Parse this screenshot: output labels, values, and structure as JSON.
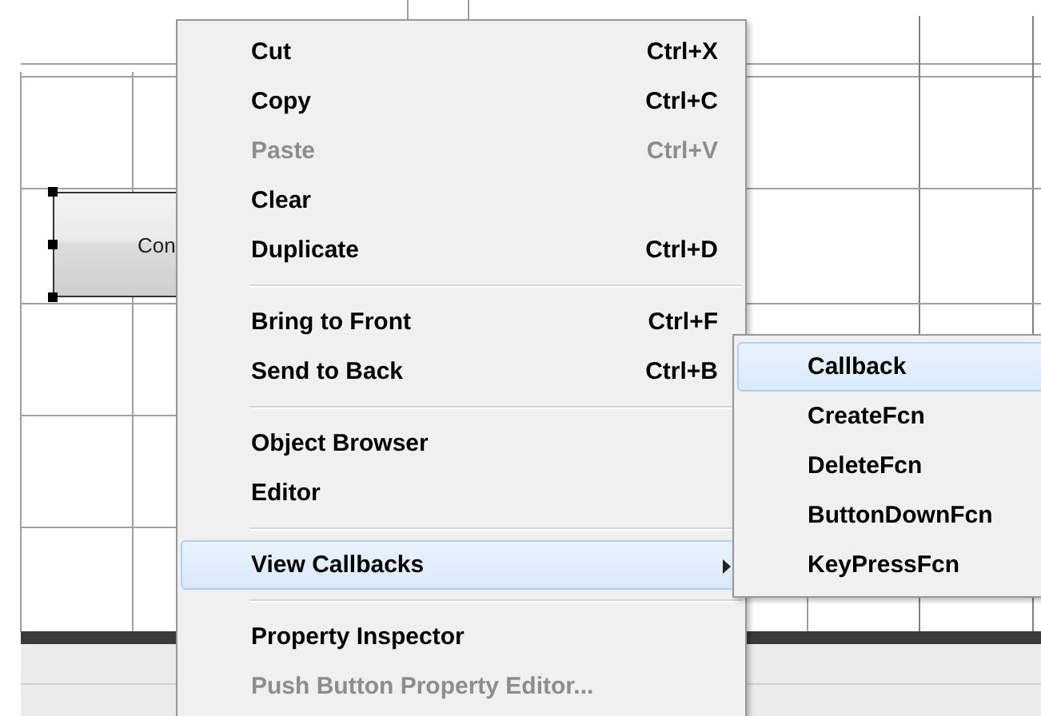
{
  "canvas": {
    "button": {
      "label": "Con",
      "selected": true
    }
  },
  "context_menu": {
    "items": [
      {
        "kind": "item",
        "label": "Cut",
        "shortcut": "Ctrl+X",
        "disabled": false,
        "selected": false
      },
      {
        "kind": "item",
        "label": "Copy",
        "shortcut": "Ctrl+C",
        "disabled": false,
        "selected": false
      },
      {
        "kind": "item",
        "label": "Paste",
        "shortcut": "Ctrl+V",
        "disabled": true,
        "selected": false
      },
      {
        "kind": "item",
        "label": "Clear",
        "disabled": false,
        "selected": false
      },
      {
        "kind": "item",
        "label": "Duplicate",
        "shortcut": "Ctrl+D",
        "disabled": false,
        "selected": false
      },
      {
        "kind": "separator"
      },
      {
        "kind": "item",
        "label": "Bring to Front",
        "shortcut": "Ctrl+F",
        "disabled": false,
        "selected": false
      },
      {
        "kind": "item",
        "label": "Send to Back",
        "shortcut": "Ctrl+B",
        "disabled": false,
        "selected": false
      },
      {
        "kind": "separator"
      },
      {
        "kind": "item",
        "label": "Object Browser",
        "disabled": false,
        "selected": false
      },
      {
        "kind": "item",
        "label": "Editor",
        "disabled": false,
        "selected": false
      },
      {
        "kind": "separator"
      },
      {
        "kind": "submenu",
        "label": "View Callbacks",
        "disabled": false,
        "selected": true
      },
      {
        "kind": "separator"
      },
      {
        "kind": "item",
        "label": "Property Inspector",
        "disabled": false,
        "selected": false
      },
      {
        "kind": "item",
        "label": "Push Button Property Editor...",
        "disabled": true,
        "selected": false
      }
    ]
  },
  "submenu": {
    "items": [
      {
        "label": "Callback",
        "selected": true
      },
      {
        "label": "CreateFcn",
        "selected": false
      },
      {
        "label": "DeleteFcn",
        "selected": false
      },
      {
        "label": "ButtonDownFcn",
        "selected": false
      },
      {
        "label": "KeyPressFcn",
        "selected": false
      }
    ]
  }
}
